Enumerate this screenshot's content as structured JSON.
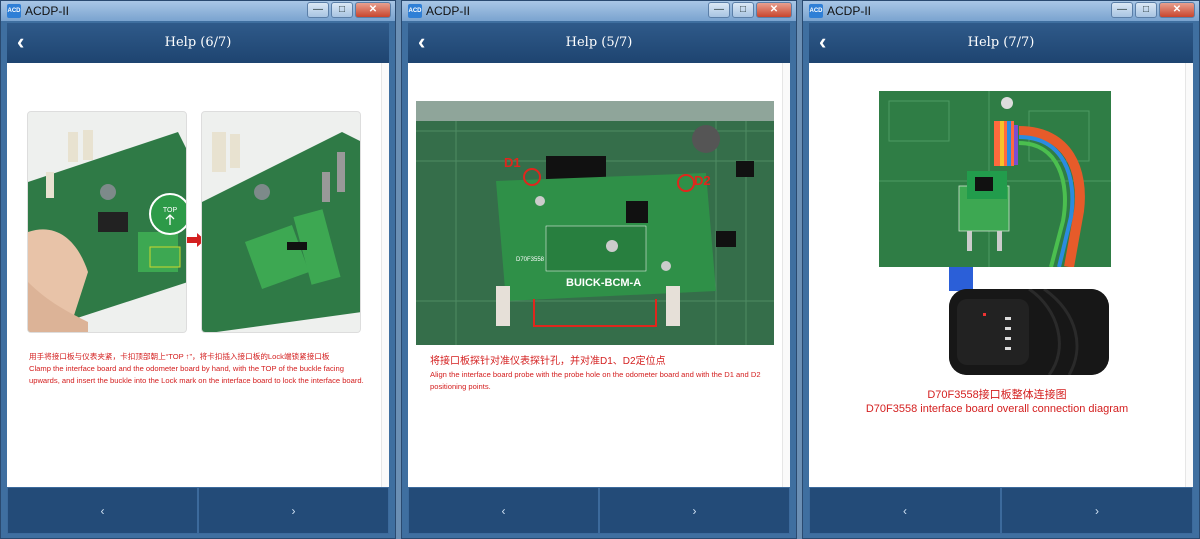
{
  "window": {
    "app_title": "ACDP-II",
    "minimize": "—",
    "maximize": "□",
    "close": "✕",
    "app_icon": "app-logo-icon"
  },
  "panels": [
    {
      "title": "Help (6/7)",
      "caption_zh": "用手将接口板与仪表夹紧，卡扣顶部朝上“TOP ↑”，将卡扣插入接口板的Lock端锁紧接口板",
      "caption_en": "Clamp the interface board and the odometer board by hand, with the TOP of the buckle facing upwards, and insert the buckle into the Lock mark on the interface board to lock the interface board.",
      "photo_label": "TOP",
      "prev": "‹",
      "next": "›"
    },
    {
      "title": "Help (5/7)",
      "caption_zh": "将接口板探针对准仪表探针孔，并对准D1、D2定位点",
      "caption_en": "Align the interface board probe with the probe hole on the odometer board and with the D1 and D2 positioning points.",
      "photo_labels": {
        "d1": "D1",
        "d2": "D2",
        "board": "BUICK-BCM-A",
        "model": "D70F3558"
      },
      "prev": "‹",
      "next": "›"
    },
    {
      "title": "Help (7/7)",
      "caption_zh": "D70F3558接口板整体连接图",
      "caption_en": "D70F3558 interface board overall connection diagram",
      "prev": "‹",
      "next": "›"
    }
  ],
  "colors": {
    "caption_red": "#d42020",
    "header_blue": "#1e4470",
    "pcb_green": "#2e7a45"
  }
}
